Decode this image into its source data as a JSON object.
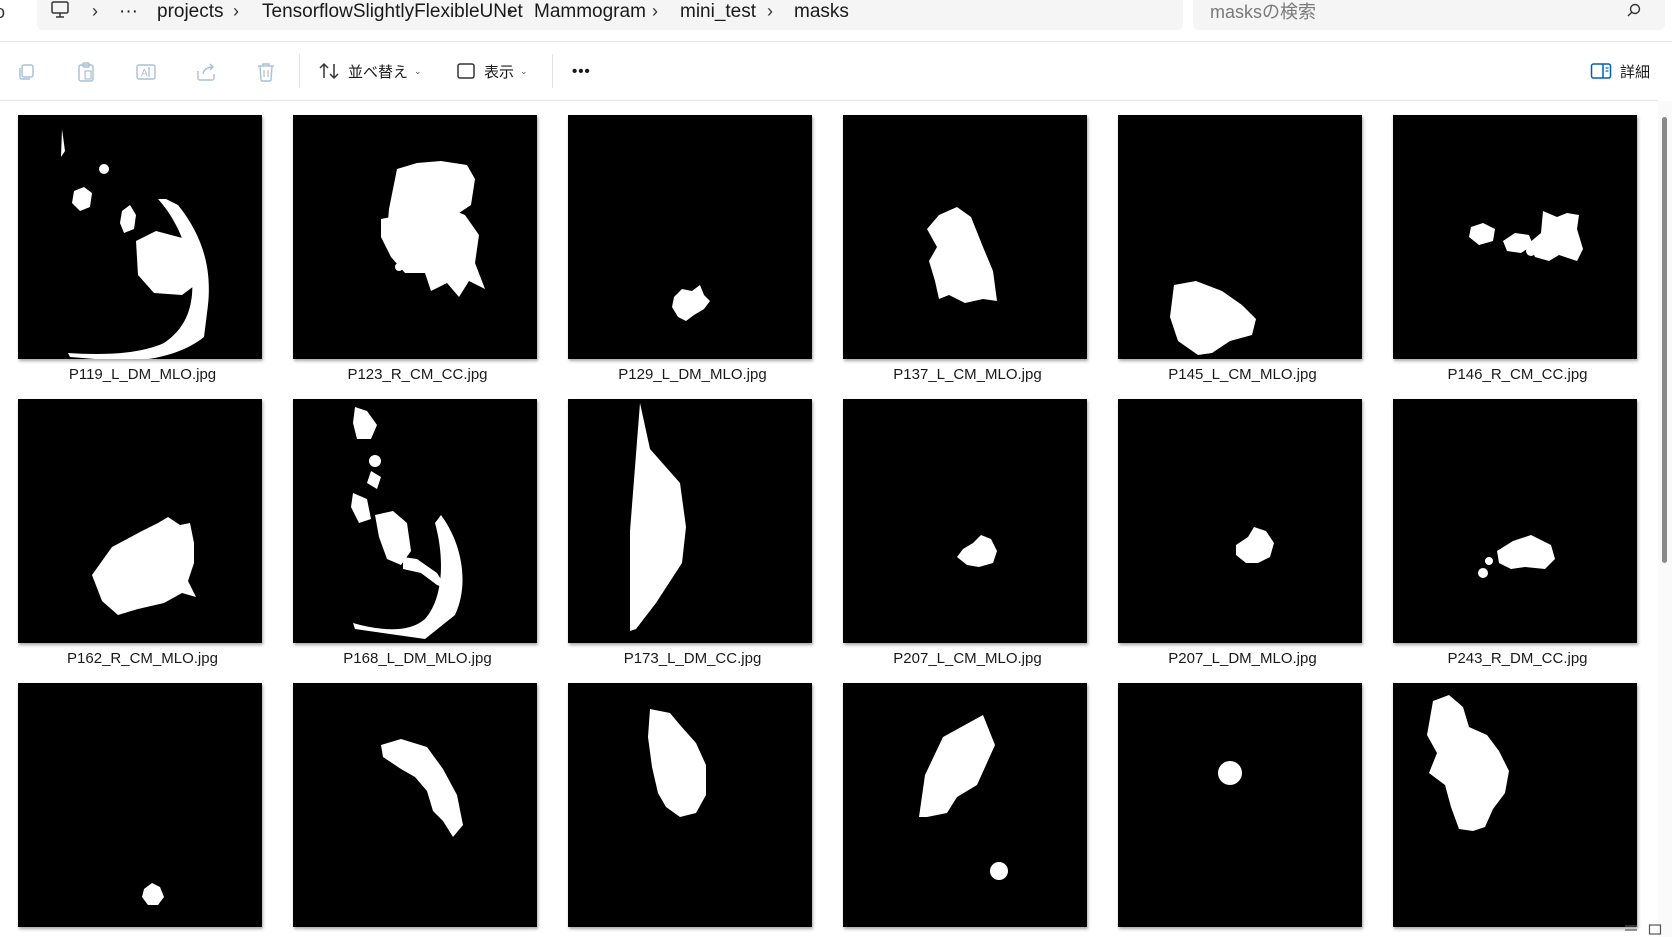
{
  "breadcrumb": {
    "more": "···",
    "items": [
      "projects",
      "TensorflowSlightlyFlexibleUNet",
      "Mammogram",
      "mini_test",
      "masks"
    ],
    "separator": "›"
  },
  "search": {
    "placeholder": "masksの検索"
  },
  "toolbar": {
    "sort_label": "並べ替え",
    "view_label": "表示",
    "more_label": "•••",
    "details_label": "詳細"
  },
  "files": [
    {
      "name": "P119_L_DM_MLO.jpg"
    },
    {
      "name": "P123_R_CM_CC.jpg"
    },
    {
      "name": "P129_L_DM_MLO.jpg"
    },
    {
      "name": "P137_L_CM_MLO.jpg"
    },
    {
      "name": "P145_L_CM_MLO.jpg"
    },
    {
      "name": "P146_R_CM_CC.jpg"
    },
    {
      "name": "P162_R_CM_MLO.jpg"
    },
    {
      "name": "P168_L_DM_MLO.jpg"
    },
    {
      "name": "P173_L_DM_CC.jpg"
    },
    {
      "name": "P207_L_CM_MLO.jpg"
    },
    {
      "name": "P207_L_DM_MLO.jpg"
    },
    {
      "name": "P243_R_DM_CC.jpg"
    },
    {
      "name": ""
    },
    {
      "name": ""
    },
    {
      "name": ""
    },
    {
      "name": ""
    },
    {
      "name": ""
    },
    {
      "name": ""
    }
  ],
  "colors": {
    "accent": "#005fb8",
    "thumb_bg": "#000000",
    "mask": "#ffffff"
  }
}
